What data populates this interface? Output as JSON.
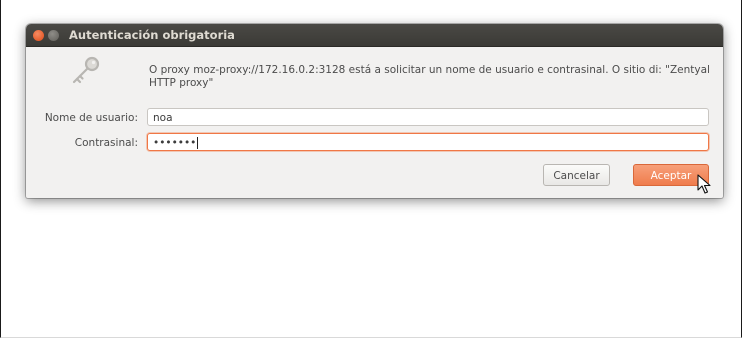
{
  "dialog": {
    "title": "Autenticación obrigatoria",
    "message": "O proxy moz-proxy://172.16.0.2:3128 está a solicitar un nome de usuario e contrasinal. O sitio di: \"Zentyal HTTP proxy\"",
    "username_label": "Nome de usuario:",
    "username_value": "noa",
    "password_label": "Contrasinal:",
    "password_value": "•••••••",
    "cancel_label": "Cancelar",
    "accept_label": "Aceptar"
  },
  "icons": {
    "dialog_icon": "key-icon",
    "close": "close-icon",
    "minimize": "minimize-icon",
    "pointer": "mouse-pointer-icon"
  },
  "colors": {
    "titlebar": "#3b3a36",
    "close_button": "#df4a16",
    "accent": "#ef7c4c",
    "dialog_bg": "#f2f1f0"
  }
}
